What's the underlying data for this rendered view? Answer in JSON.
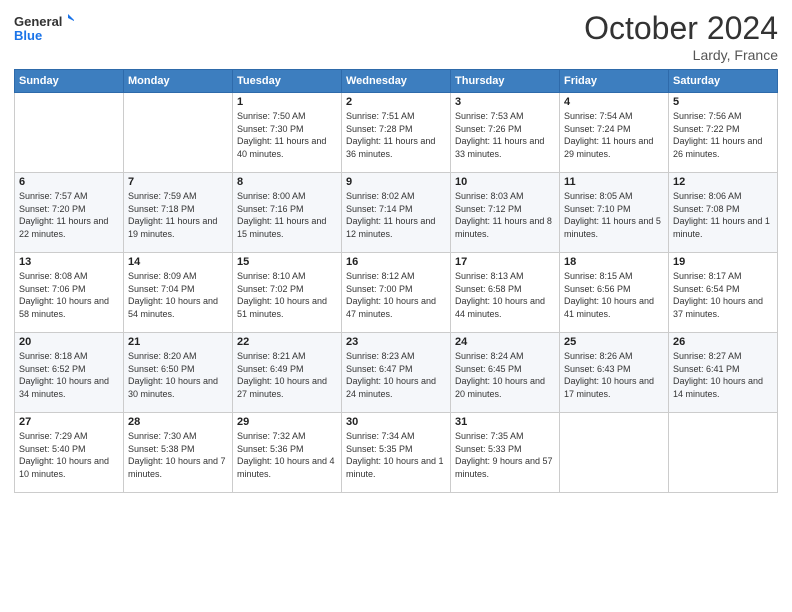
{
  "logo": {
    "line1": "General",
    "line2": "Blue"
  },
  "header": {
    "title": "October 2024",
    "subtitle": "Lardy, France"
  },
  "weekdays": [
    "Sunday",
    "Monday",
    "Tuesday",
    "Wednesday",
    "Thursday",
    "Friday",
    "Saturday"
  ],
  "weeks": [
    [
      {
        "day": "",
        "info": ""
      },
      {
        "day": "",
        "info": ""
      },
      {
        "day": "1",
        "info": "Sunrise: 7:50 AM\nSunset: 7:30 PM\nDaylight: 11 hours and 40 minutes."
      },
      {
        "day": "2",
        "info": "Sunrise: 7:51 AM\nSunset: 7:28 PM\nDaylight: 11 hours and 36 minutes."
      },
      {
        "day": "3",
        "info": "Sunrise: 7:53 AM\nSunset: 7:26 PM\nDaylight: 11 hours and 33 minutes."
      },
      {
        "day": "4",
        "info": "Sunrise: 7:54 AM\nSunset: 7:24 PM\nDaylight: 11 hours and 29 minutes."
      },
      {
        "day": "5",
        "info": "Sunrise: 7:56 AM\nSunset: 7:22 PM\nDaylight: 11 hours and 26 minutes."
      }
    ],
    [
      {
        "day": "6",
        "info": "Sunrise: 7:57 AM\nSunset: 7:20 PM\nDaylight: 11 hours and 22 minutes."
      },
      {
        "day": "7",
        "info": "Sunrise: 7:59 AM\nSunset: 7:18 PM\nDaylight: 11 hours and 19 minutes."
      },
      {
        "day": "8",
        "info": "Sunrise: 8:00 AM\nSunset: 7:16 PM\nDaylight: 11 hours and 15 minutes."
      },
      {
        "day": "9",
        "info": "Sunrise: 8:02 AM\nSunset: 7:14 PM\nDaylight: 11 hours and 12 minutes."
      },
      {
        "day": "10",
        "info": "Sunrise: 8:03 AM\nSunset: 7:12 PM\nDaylight: 11 hours and 8 minutes."
      },
      {
        "day": "11",
        "info": "Sunrise: 8:05 AM\nSunset: 7:10 PM\nDaylight: 11 hours and 5 minutes."
      },
      {
        "day": "12",
        "info": "Sunrise: 8:06 AM\nSunset: 7:08 PM\nDaylight: 11 hours and 1 minute."
      }
    ],
    [
      {
        "day": "13",
        "info": "Sunrise: 8:08 AM\nSunset: 7:06 PM\nDaylight: 10 hours and 58 minutes."
      },
      {
        "day": "14",
        "info": "Sunrise: 8:09 AM\nSunset: 7:04 PM\nDaylight: 10 hours and 54 minutes."
      },
      {
        "day": "15",
        "info": "Sunrise: 8:10 AM\nSunset: 7:02 PM\nDaylight: 10 hours and 51 minutes."
      },
      {
        "day": "16",
        "info": "Sunrise: 8:12 AM\nSunset: 7:00 PM\nDaylight: 10 hours and 47 minutes."
      },
      {
        "day": "17",
        "info": "Sunrise: 8:13 AM\nSunset: 6:58 PM\nDaylight: 10 hours and 44 minutes."
      },
      {
        "day": "18",
        "info": "Sunrise: 8:15 AM\nSunset: 6:56 PM\nDaylight: 10 hours and 41 minutes."
      },
      {
        "day": "19",
        "info": "Sunrise: 8:17 AM\nSunset: 6:54 PM\nDaylight: 10 hours and 37 minutes."
      }
    ],
    [
      {
        "day": "20",
        "info": "Sunrise: 8:18 AM\nSunset: 6:52 PM\nDaylight: 10 hours and 34 minutes."
      },
      {
        "day": "21",
        "info": "Sunrise: 8:20 AM\nSunset: 6:50 PM\nDaylight: 10 hours and 30 minutes."
      },
      {
        "day": "22",
        "info": "Sunrise: 8:21 AM\nSunset: 6:49 PM\nDaylight: 10 hours and 27 minutes."
      },
      {
        "day": "23",
        "info": "Sunrise: 8:23 AM\nSunset: 6:47 PM\nDaylight: 10 hours and 24 minutes."
      },
      {
        "day": "24",
        "info": "Sunrise: 8:24 AM\nSunset: 6:45 PM\nDaylight: 10 hours and 20 minutes."
      },
      {
        "day": "25",
        "info": "Sunrise: 8:26 AM\nSunset: 6:43 PM\nDaylight: 10 hours and 17 minutes."
      },
      {
        "day": "26",
        "info": "Sunrise: 8:27 AM\nSunset: 6:41 PM\nDaylight: 10 hours and 14 minutes."
      }
    ],
    [
      {
        "day": "27",
        "info": "Sunrise: 7:29 AM\nSunset: 5:40 PM\nDaylight: 10 hours and 10 minutes."
      },
      {
        "day": "28",
        "info": "Sunrise: 7:30 AM\nSunset: 5:38 PM\nDaylight: 10 hours and 7 minutes."
      },
      {
        "day": "29",
        "info": "Sunrise: 7:32 AM\nSunset: 5:36 PM\nDaylight: 10 hours and 4 minutes."
      },
      {
        "day": "30",
        "info": "Sunrise: 7:34 AM\nSunset: 5:35 PM\nDaylight: 10 hours and 1 minute."
      },
      {
        "day": "31",
        "info": "Sunrise: 7:35 AM\nSunset: 5:33 PM\nDaylight: 9 hours and 57 minutes."
      },
      {
        "day": "",
        "info": ""
      },
      {
        "day": "",
        "info": ""
      }
    ]
  ]
}
